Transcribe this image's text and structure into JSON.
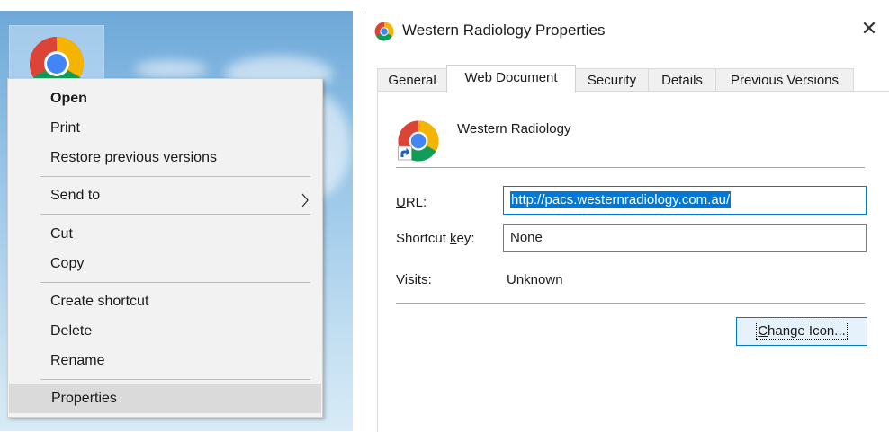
{
  "desktop": {
    "icon_name": "chrome-shortcut-icon"
  },
  "context_menu": {
    "items": [
      {
        "label": "Open",
        "bold": true
      },
      {
        "label": "Print"
      },
      {
        "label": "Restore previous versions"
      },
      {
        "label": "Send to",
        "submenu": true
      },
      {
        "label": "Cut"
      },
      {
        "label": "Copy"
      },
      {
        "label": "Create shortcut"
      },
      {
        "label": "Delete"
      },
      {
        "label": "Rename"
      },
      {
        "label": "Properties",
        "highlighted": true
      }
    ]
  },
  "dialog": {
    "title": "Western Radiology Properties",
    "close_glyph": "✕",
    "tabs": [
      "General",
      "Web Document",
      "Security",
      "Details",
      "Previous Versions"
    ],
    "active_tab": "Web Document",
    "site_name": "Western Radiology",
    "url_label_u": "U",
    "url_label_rest": "RL:",
    "url_value": "http://pacs.westernradiology.com.au/",
    "shortcut_label_pre": "Shortcut ",
    "shortcut_label_u": "k",
    "shortcut_label_rest": "ey:",
    "shortcut_value": "None",
    "visits_label": "Visits:",
    "visits_value": "Unknown",
    "change_icon_u": "C",
    "change_icon_rest": "hange Icon..."
  },
  "colors": {
    "accent": "#0078d7",
    "menu_bg": "#f2f2f2",
    "highlight": "#dadada"
  }
}
